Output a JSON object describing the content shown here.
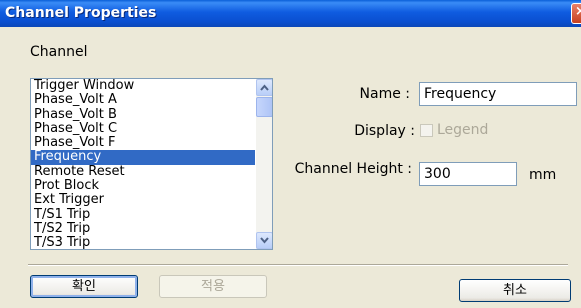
{
  "window": {
    "title": "Channel Properties"
  },
  "group": {
    "label": "Channel"
  },
  "channel_list": {
    "items": [
      "Trigger Window",
      "Phase_Volt A",
      "Phase_Volt B",
      "Phase_Volt C",
      "Phase_Volt F",
      "Frequency",
      "Remote Reset",
      "Prot Block",
      "Ext Trigger",
      "T/S1 Trip",
      "T/S2 Trip",
      "T/S3 Trip"
    ],
    "selected": "Frequency"
  },
  "fields": {
    "name_label": "Name :",
    "name_value": "Frequency",
    "display_label": "Display :",
    "legend_label": "Legend",
    "legend_checked": false,
    "legend_enabled": false,
    "height_label": "Channel Height :",
    "height_value": "300",
    "height_unit": "mm"
  },
  "buttons": {
    "ok": "확인",
    "apply": "적용",
    "cancel": "취소"
  }
}
